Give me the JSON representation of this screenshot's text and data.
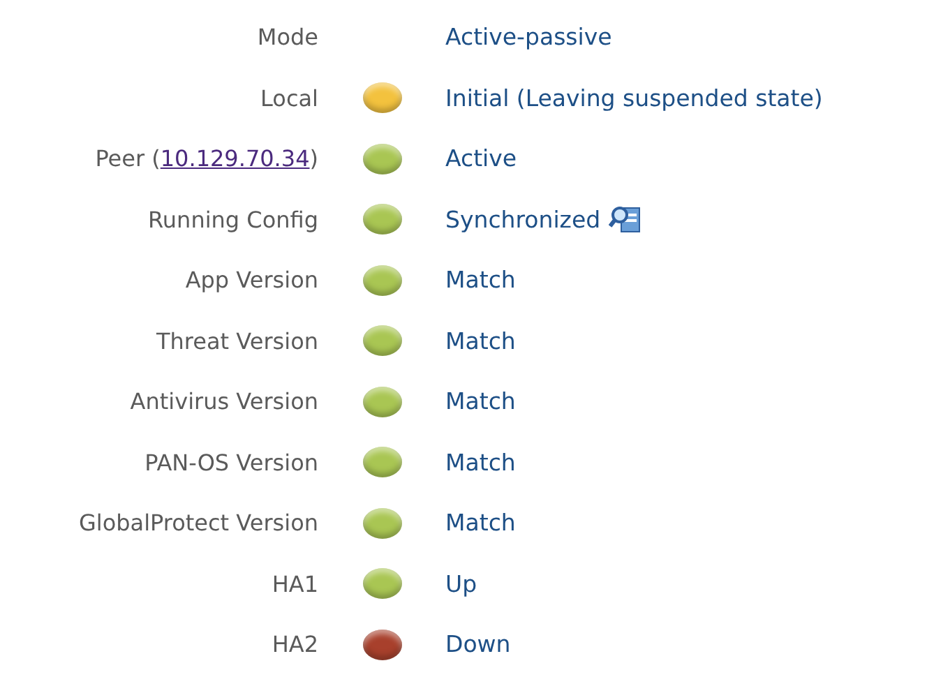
{
  "rows": [
    {
      "label": "Mode",
      "value": "Active-passive"
    },
    {
      "label": "Local",
      "color": "#f3c23e",
      "value": "Initial (Leaving suspended state)"
    },
    {
      "label": "Peer (",
      "link": "10.129.70.34",
      "label_end": ")",
      "color": "#a9c653",
      "value": "Active"
    },
    {
      "label": "Running Config",
      "color": "#a9c653",
      "value": "Synchronized",
      "action_icon": true
    },
    {
      "label": "App Version",
      "color": "#a9c653",
      "value": "Match"
    },
    {
      "label": "Threat Version",
      "color": "#a9c653",
      "value": "Match"
    },
    {
      "label": "Antivirus Version",
      "color": "#a9c653",
      "value": "Match"
    },
    {
      "label": "PAN-OS Version",
      "color": "#a9c653",
      "value": "Match"
    },
    {
      "label": "GlobalProtect Version",
      "color": "#a9c653",
      "value": "Match"
    },
    {
      "label": "HA1",
      "color": "#a9c653",
      "value": "Up"
    },
    {
      "label": "HA2",
      "color": "#a8402c",
      "value": "Down"
    }
  ]
}
